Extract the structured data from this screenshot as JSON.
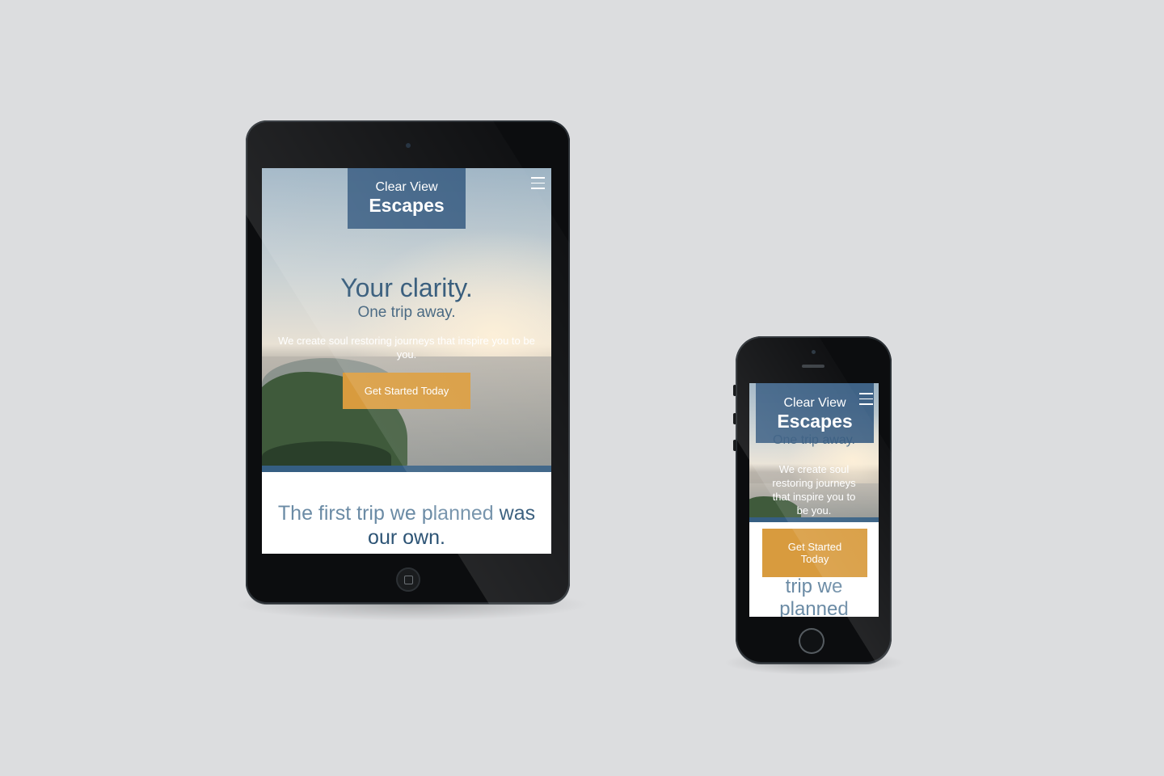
{
  "site": {
    "brand_line1": "Clear View",
    "brand_line2": "Escapes",
    "hero_title": "Your clarity.",
    "hero_subtitle": "One trip away.",
    "hero_description": "We create soul restoring journeys that inspire you to be you.",
    "cta_label": "Get Started Today",
    "story_light": "The first trip we planned",
    "story_bold": "was our own."
  },
  "phone_view": {
    "subtitle_fragment": "One trip away.",
    "description_lines": [
      "We create soul",
      "restoring journeys",
      "that inspire you to",
      "be you."
    ],
    "cta_line1": "Get Started",
    "cta_line2": "Today",
    "story_line1": "trip we",
    "story_line2": "planned"
  },
  "colors": {
    "background": "#dcdddf",
    "brand_blue": "#31567d",
    "headline_blue": "#2d5475",
    "cta_orange": "#d89b3e"
  },
  "icons": {
    "menu": "hamburger-menu-icon"
  }
}
